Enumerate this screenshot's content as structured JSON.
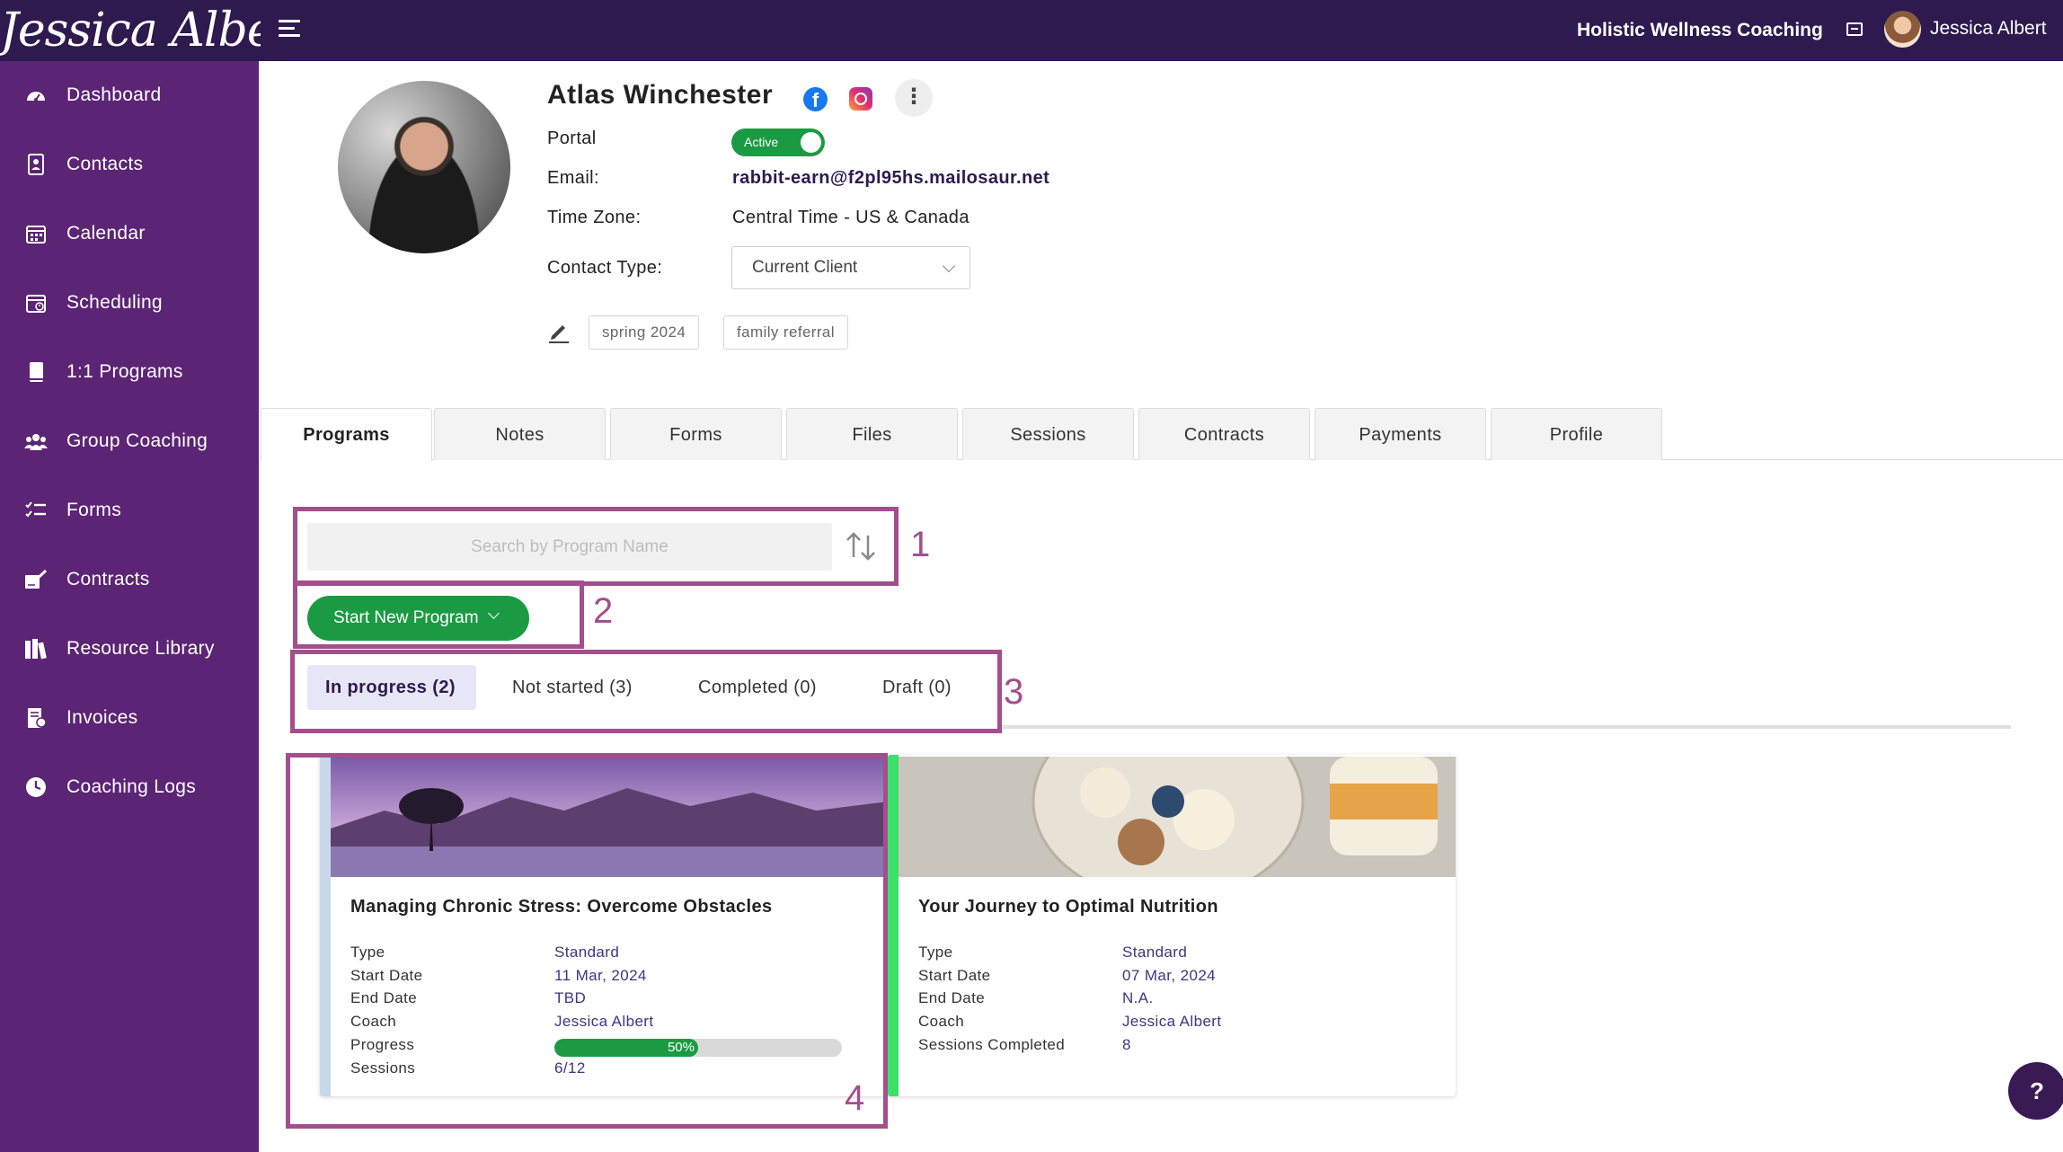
{
  "app": {
    "logo_text": "Jessica Albert",
    "org_name": "Holistic Wellness Coaching",
    "user_name": "Jessica Albert"
  },
  "colors": {
    "topbar": "#2e1a4f",
    "sidebar": "#5c2474",
    "primary_green": "#1a9b43",
    "annotation": "#a44e8d"
  },
  "sidebar": {
    "items": [
      {
        "label": "Dashboard",
        "icon": "dashboard-gauge-icon"
      },
      {
        "label": "Contacts",
        "icon": "contacts-book-icon"
      },
      {
        "label": "Calendar",
        "icon": "calendar-icon"
      },
      {
        "label": "Scheduling",
        "icon": "scheduling-calendar-icon"
      },
      {
        "label": "1:1 Programs",
        "icon": "book-icon"
      },
      {
        "label": "Group Coaching",
        "icon": "group-icon"
      },
      {
        "label": "Forms",
        "icon": "checklist-icon"
      },
      {
        "label": "Contracts",
        "icon": "signature-icon"
      },
      {
        "label": "Resource Library",
        "icon": "library-icon"
      },
      {
        "label": "Invoices",
        "icon": "invoice-icon"
      },
      {
        "label": "Coaching Logs",
        "icon": "clock-icon"
      }
    ]
  },
  "contact": {
    "name": "Atlas Winchester",
    "more_icon": "⋮",
    "fb_letter": "f",
    "portal_label": "Portal",
    "portal_status": "Active",
    "email_label": "Email:",
    "email": "rabbit-earn@f2pl95hs.mailosaur.net",
    "timezone_label": "Time Zone:",
    "timezone": "Central Time - US & Canada",
    "type_label": "Contact Type:",
    "type_value": "Current Client",
    "tags": [
      "spring 2024",
      "family referral"
    ]
  },
  "tabs": [
    "Programs",
    "Notes",
    "Forms",
    "Files",
    "Sessions",
    "Contracts",
    "Payments",
    "Profile"
  ],
  "programs": {
    "search_placeholder": "Search by Program Name",
    "start_button": "Start New Program",
    "status_tabs": [
      "In progress (2)",
      "Not started (3)",
      "Completed (0)",
      "Draft (0)"
    ]
  },
  "annotations": [
    "1",
    "2",
    "3",
    "4"
  ],
  "cards": [
    {
      "title": "Managing Chronic Stress: Overcome Obstacles",
      "accent": "#c8d8ea",
      "rows": [
        {
          "label": "Type",
          "value": "Standard"
        },
        {
          "label": "Start Date",
          "value": "11 Mar, 2024"
        },
        {
          "label": "End Date",
          "value": "TBD"
        },
        {
          "label": "Coach",
          "value": "Jessica Albert"
        },
        {
          "label": "Progress",
          "value": ""
        },
        {
          "label": "Sessions",
          "value": "6/12"
        }
      ],
      "progress_pct": 50,
      "progress_text": "50%"
    },
    {
      "title": "Your Journey to Optimal Nutrition",
      "accent": "#3be06a",
      "rows": [
        {
          "label": "Type",
          "value": "Standard"
        },
        {
          "label": "Start Date",
          "value": "07 Mar, 2024"
        },
        {
          "label": "End Date",
          "value": "N.A."
        },
        {
          "label": "Coach",
          "value": "Jessica Albert"
        },
        {
          "label": "Sessions Completed",
          "value": "8"
        }
      ]
    }
  ],
  "help_label": "?"
}
